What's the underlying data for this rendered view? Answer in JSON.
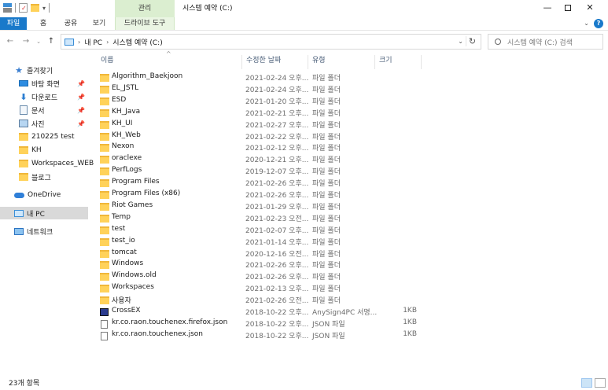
{
  "window": {
    "title": "시스템 예약 (C:)",
    "context_tab_top": "관리"
  },
  "ribbon": {
    "tabs": [
      "파일",
      "홈",
      "공유",
      "보기"
    ],
    "context_tab": "드라이브 도구"
  },
  "address": {
    "crumbs": [
      "내 PC",
      "시스템 예약 (C:)"
    ]
  },
  "search": {
    "placeholder": "시스템 예약 (C:) 검색"
  },
  "nav_pane": {
    "quick_access": "즐겨찾기",
    "items": [
      {
        "label": "바탕 화면",
        "icon": "desktop-icon",
        "pinned": true
      },
      {
        "label": "다운로드",
        "icon": "download-icon",
        "pinned": true
      },
      {
        "label": "문서",
        "icon": "document-icon",
        "pinned": true
      },
      {
        "label": "사진",
        "icon": "pictures-icon",
        "pinned": true
      },
      {
        "label": "210225 test",
        "icon": "folder-icon",
        "pinned": false
      },
      {
        "label": "KH",
        "icon": "folder-icon",
        "pinned": false
      },
      {
        "label": "Workspaces_WEB",
        "icon": "folder-icon",
        "pinned": false
      },
      {
        "label": "블로그",
        "icon": "folder-icon",
        "pinned": false
      }
    ],
    "onedrive": "OneDrive",
    "this_pc": "내 PC",
    "network": "네트워크"
  },
  "columns": {
    "name": "이름",
    "date": "수정한 날짜",
    "type": "유형",
    "size": "크기"
  },
  "files": [
    {
      "name": "Algorithm_Baekjoon",
      "date": "2021-02-24 오후...",
      "type": "파일 폴더",
      "size": "",
      "icon": "folder-icon"
    },
    {
      "name": "EL_JSTL",
      "date": "2021-02-24 오후...",
      "type": "파일 폴더",
      "size": "",
      "icon": "folder-icon"
    },
    {
      "name": "ESD",
      "date": "2021-01-20 오후...",
      "type": "파일 폴더",
      "size": "",
      "icon": "folder-icon"
    },
    {
      "name": "KH_Java",
      "date": "2021-02-21 오후...",
      "type": "파일 폴더",
      "size": "",
      "icon": "folder-icon"
    },
    {
      "name": "KH_UI",
      "date": "2021-02-27 오후...",
      "type": "파일 폴더",
      "size": "",
      "icon": "folder-icon"
    },
    {
      "name": "KH_Web",
      "date": "2021-02-22 오후...",
      "type": "파일 폴더",
      "size": "",
      "icon": "folder-icon"
    },
    {
      "name": "Nexon",
      "date": "2021-02-12 오후...",
      "type": "파일 폴더",
      "size": "",
      "icon": "folder-icon"
    },
    {
      "name": "oraclexe",
      "date": "2020-12-21 오후...",
      "type": "파일 폴더",
      "size": "",
      "icon": "folder-icon"
    },
    {
      "name": "PerfLogs",
      "date": "2019-12-07 오후...",
      "type": "파일 폴더",
      "size": "",
      "icon": "folder-icon"
    },
    {
      "name": "Program Files",
      "date": "2021-02-26 오후...",
      "type": "파일 폴더",
      "size": "",
      "icon": "folder-icon"
    },
    {
      "name": "Program Files (x86)",
      "date": "2021-02-26 오후...",
      "type": "파일 폴더",
      "size": "",
      "icon": "folder-icon"
    },
    {
      "name": "Riot Games",
      "date": "2021-01-29 오후...",
      "type": "파일 폴더",
      "size": "",
      "icon": "folder-icon"
    },
    {
      "name": "Temp",
      "date": "2021-02-23 오전...",
      "type": "파일 폴더",
      "size": "",
      "icon": "folder-icon"
    },
    {
      "name": "test",
      "date": "2021-02-07 오후...",
      "type": "파일 폴더",
      "size": "",
      "icon": "folder-icon"
    },
    {
      "name": "test_io",
      "date": "2021-01-14 오후...",
      "type": "파일 폴더",
      "size": "",
      "icon": "folder-icon"
    },
    {
      "name": "tomcat",
      "date": "2020-12-16 오전...",
      "type": "파일 폴더",
      "size": "",
      "icon": "folder-icon"
    },
    {
      "name": "Windows",
      "date": "2021-02-26 오후...",
      "type": "파일 폴더",
      "size": "",
      "icon": "folder-icon"
    },
    {
      "name": "Windows.old",
      "date": "2021-02-26 오후...",
      "type": "파일 폴더",
      "size": "",
      "icon": "folder-icon"
    },
    {
      "name": "Workspaces",
      "date": "2021-02-13 오후...",
      "type": "파일 폴더",
      "size": "",
      "icon": "folder-icon"
    },
    {
      "name": "사용자",
      "date": "2021-02-26 오전...",
      "type": "파일 폴더",
      "size": "",
      "icon": "folder-icon"
    },
    {
      "name": "CrossEX",
      "date": "2018-10-22 오후...",
      "type": "AnySign4PC 서명...",
      "size": "1KB",
      "icon": "app-icon"
    },
    {
      "name": "kr.co.raon.touchenex.firefox.json",
      "date": "2018-10-22 오후...",
      "type": "JSON 파일",
      "size": "1KB",
      "icon": "file-icon"
    },
    {
      "name": "kr.co.raon.touchenex.json",
      "date": "2018-10-22 오후...",
      "type": "JSON 파일",
      "size": "1KB",
      "icon": "file-icon"
    }
  ],
  "status": {
    "item_count": "23개 항목"
  }
}
